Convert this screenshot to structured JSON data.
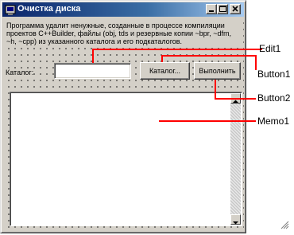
{
  "window": {
    "title": "Очистка диска",
    "caption_buttons": [
      "minimize-icon",
      "maximize-icon",
      "close-icon"
    ]
  },
  "form": {
    "description": "Программа удалит ненужные, созданные в процессе компиляции проектов C++Builder, файлы (obj, tds и резервные копии ~bpr, ~dfm, ~h, ~cpp) из указанного каталога и его подкаталогов.",
    "catalog_label": "Каталог:",
    "catalog_value": "",
    "browse_button": "Каталог...",
    "run_button": "Выполнить",
    "memo_text": ""
  },
  "annotations": {
    "edit1": "Edit1",
    "button1": "Button1",
    "button2": "Button2",
    "memo1": "Memo1",
    "line_color": "#ff0000"
  }
}
